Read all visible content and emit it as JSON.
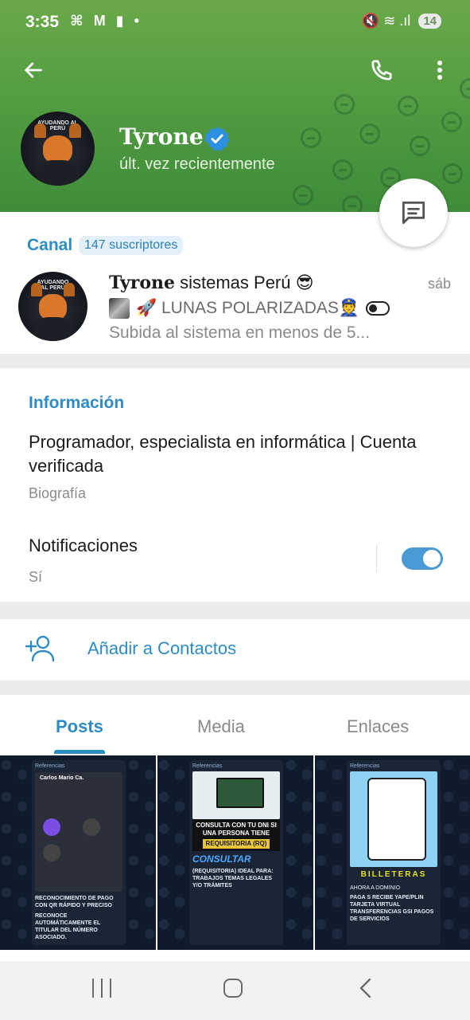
{
  "status_bar": {
    "time": "3:35",
    "left_icons": "⌘ M ▮ •",
    "right_icons": "🔇 ≋ .ıl",
    "battery": "14"
  },
  "header": {
    "back_icon": "arrow-left-icon",
    "call_icon": "phone-icon",
    "more_icon": "more-vertical-icon",
    "avatar_caption": "AYUDANDO AL PERÚ",
    "name": "Tyrone",
    "status": "últ. vez recientemente",
    "accent": "#4f9a40"
  },
  "channel": {
    "label": "Canal",
    "subscribers": "147 suscriptores",
    "title_bold": "Tyrone",
    "title_rest": " sistemas Perú 😎",
    "date": "sáb",
    "preview_line": "🚀 LUNAS POLARIZADAS👮",
    "preview_text": "Subida al sistema en menos de 5..."
  },
  "info": {
    "heading": "Información",
    "bio": "Programador, especialista en informática | Cuenta verificada",
    "bio_label": "Biografía",
    "notifications_title": "Notificaciones",
    "notifications_value": "Sí",
    "notifications_on": true
  },
  "contacts": {
    "add_label": "Añadir a Contactos"
  },
  "tabs": {
    "posts": "Posts",
    "media": "Media",
    "links": "Enlaces",
    "active": "Posts"
  },
  "posts": [
    {
      "ref": "Referencias",
      "header": "Carlos Mario Ca.",
      "caption1": "RECONOCIMIENTO DE PAGO CON QR RÁPIDO Y PRECISO",
      "caption2": "RECONOCE AUTOMÁTICAMENTE EL TITULAR DEL NÚMERO ASOCIADO."
    },
    {
      "ref": "Referencias",
      "title": "CONSULTA CON TU DNI SI UNA PERSONA TIENE",
      "badge": "REQUISITORIA (RQ)",
      "consultar": "CONSULTAR",
      "items": "(REQUISITORIA) IDEAL PARA: TRABAJOS TEMAS LEGALES Y/O TRÁMITES"
    },
    {
      "ref": "Referencias",
      "billeteras": "BILLETERAS",
      "dominio": "AHORA A DOMINIO",
      "items": "PAGA S RECIBE YAPE/PLIN TARJETA VIRTUAL TRANSFERENCIAS GSI PAGOS DE SERVICIOS"
    }
  ],
  "colors": {
    "link_blue": "#2d8bc6",
    "toggle_blue": "#4a9ad6",
    "muted": "#8a8a8a"
  }
}
